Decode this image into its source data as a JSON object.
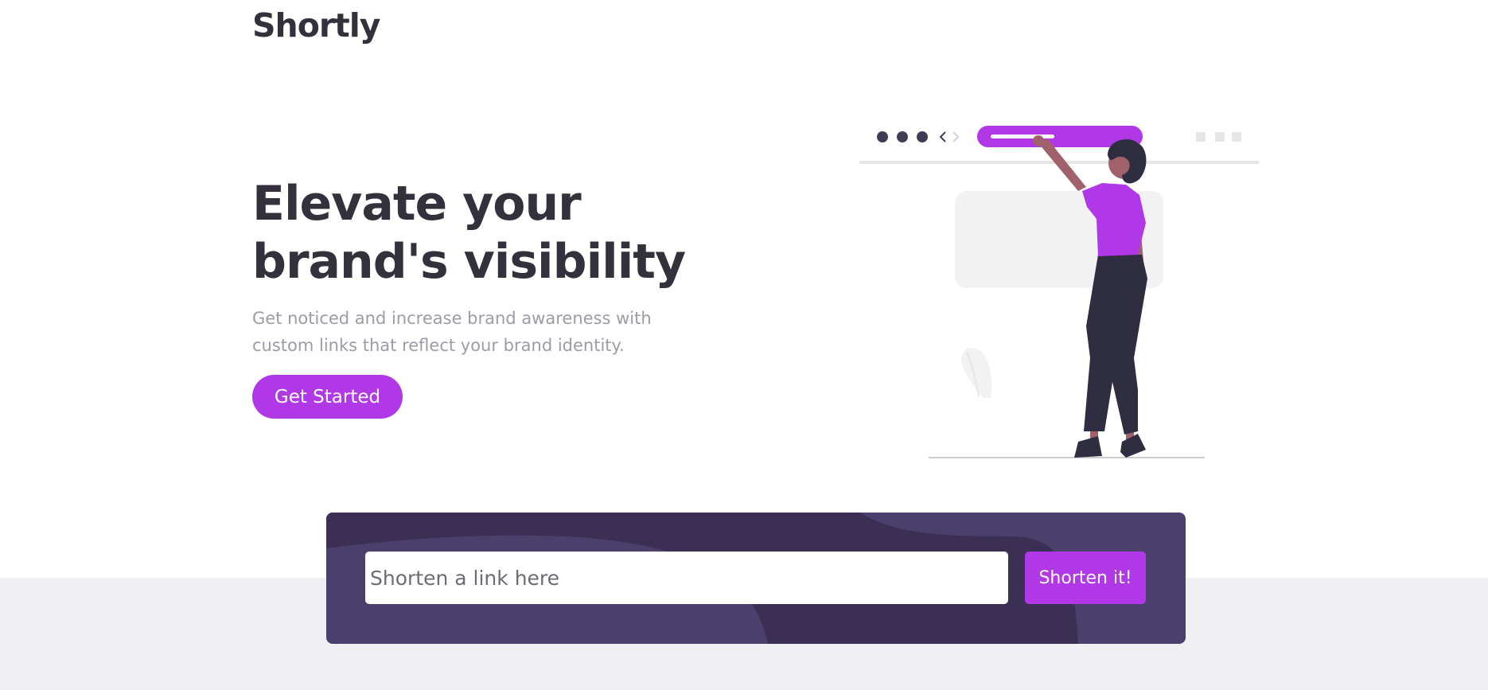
{
  "brand": {
    "name": "Shortly"
  },
  "hero": {
    "headline_line1": "Elevate your",
    "headline_line2": "brand's visibility",
    "subtext_line1": "Get noticed and increase brand awareness with",
    "subtext_line2": "custom links that reflect your brand identity.",
    "cta_label": "Get Started"
  },
  "shortener": {
    "placeholder": "Shorten a link here",
    "value": "",
    "button_label": "Shorten it!"
  },
  "colors": {
    "accent": "#b138e6",
    "dark_text": "#34313d",
    "muted_text": "#9e9aa8",
    "panel_bg": "#4b3f6b",
    "panel_shape": "#3b2f54",
    "band_bg": "#efeff4"
  },
  "illustration": {
    "icon": "woman-with-browser-illustration"
  }
}
